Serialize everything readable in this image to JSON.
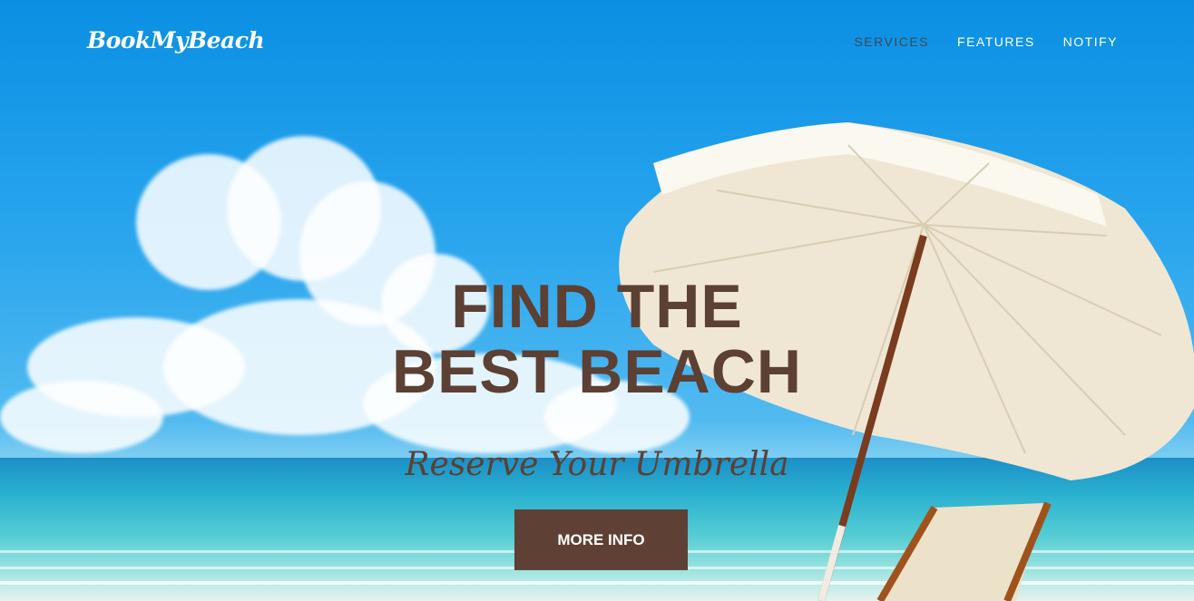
{
  "brand": {
    "name": "BookMyBeach"
  },
  "nav": {
    "items": [
      {
        "label": "SERVICES",
        "active": true
      },
      {
        "label": "FEATURES",
        "active": false
      },
      {
        "label": "NOTIFY",
        "active": false
      }
    ]
  },
  "hero": {
    "headline_line1": "FIND THE",
    "headline_line2": "BEST BEACH",
    "subheadline": "Reserve Your Umbrella",
    "cta_label": "MORE INFO"
  },
  "colors": {
    "sky": "#0a8fe3",
    "headline": "#5c4033",
    "button": "#5e4034",
    "nav_active": "#3b4a55"
  }
}
